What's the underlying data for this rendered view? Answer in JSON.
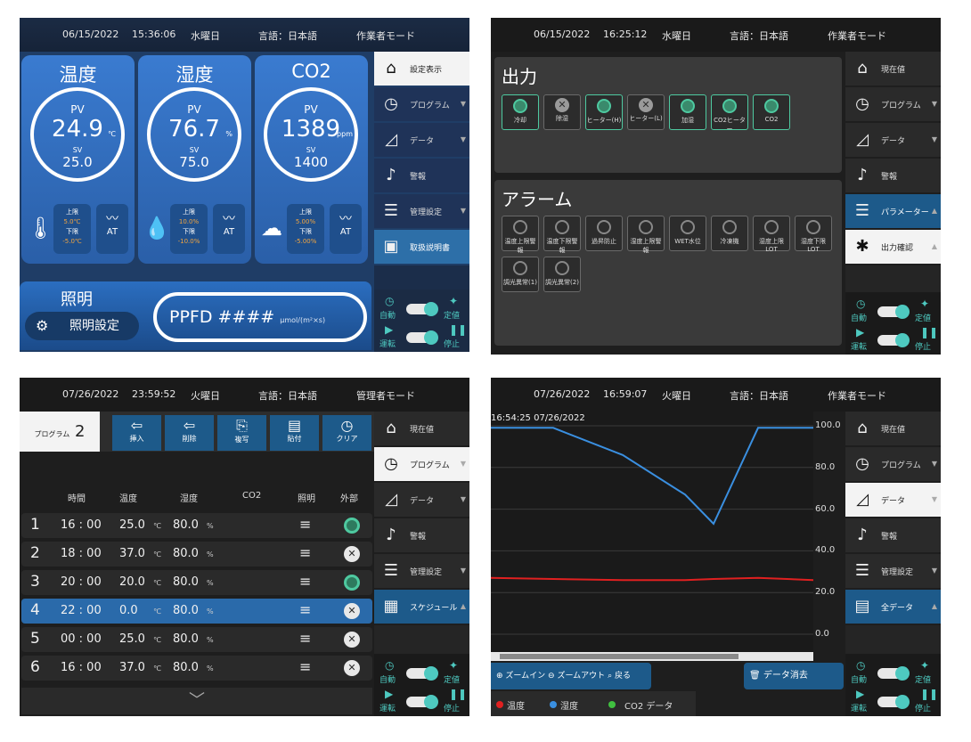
{
  "colors": {
    "accent": "#4ec9c0",
    "on_green": "#4ec9a0",
    "blue": "#1d5a8a",
    "temp_line": "#e02020",
    "humid_line": "#3a8fe0",
    "co2_dot": "#40c040"
  },
  "screen1": {
    "top_date": "06/15/2022",
    "top_time": "15:36:06",
    "top_day": "水曜日",
    "top_lang": "言語：日本語",
    "top_mode": "作業者モード",
    "gauges": [
      {
        "title": "温度",
        "pv_label": "PV",
        "value": "24.9",
        "unit": "℃",
        "sv_label": "SV",
        "setpoint": "25.0",
        "upper_label": "上限",
        "upper": "5.0℃",
        "lower_label": "下限",
        "lower": "-5.0℃",
        "at": "AT",
        "icon": "thermometer-icon"
      },
      {
        "title": "湿度",
        "pv_label": "PV",
        "value": "76.7",
        "unit": "%",
        "sv_label": "SV",
        "setpoint": "75.0",
        "upper_label": "上限",
        "upper": "10.0%",
        "lower_label": "下限",
        "lower": "-10.0%",
        "at": "AT",
        "icon": "droplet-icon"
      },
      {
        "title": "CO2",
        "pv_label": "PV",
        "value": "1389",
        "unit": "ppm",
        "sv_label": "SV",
        "setpoint": "1400",
        "upper_label": "上限",
        "upper": "5.00%",
        "lower_label": "下限",
        "lower": "-5.00%",
        "at": "AT",
        "icon": "co2-cloud-icon"
      }
    ],
    "lighting_title": "照明",
    "lighting_button": "照明設定",
    "ppfd_label": "PPFD ####",
    "ppfd_unit": "μmol/(m²×s)",
    "menu": [
      "設定表示",
      "プログラム",
      "データ",
      "警報",
      "管理設定",
      "取扱説明書"
    ],
    "ctrl_auto": "自動",
    "ctrl_fixed": "定値",
    "ctrl_run": "運転",
    "ctrl_stop": "停止"
  },
  "screen2": {
    "top_date": "06/15/2022",
    "top_time": "16:25:12",
    "top_day": "水曜日",
    "top_lang": "言語：日本語",
    "top_mode": "作業者モード",
    "output_title": "出力",
    "outputs": [
      {
        "label": "冷却",
        "on": true
      },
      {
        "label": "除湿",
        "on": false
      },
      {
        "label": "ヒーター(H)",
        "on": true
      },
      {
        "label": "ヒーター(L)",
        "on": false
      },
      {
        "label": "加湿",
        "on": true
      },
      {
        "label": "CO2ヒーター",
        "on": true
      },
      {
        "label": "CO2",
        "on": true
      }
    ],
    "alarm_title": "アラーム",
    "alarms": [
      "温度上限警報",
      "温度下限警報",
      "過昇防止",
      "湿度上限警報",
      "WET水位",
      "冷凍機",
      "湿度上限LOT",
      "湿度下限LOT",
      "調光異常(1)",
      "調光異常(2)"
    ],
    "menu": [
      "現在値",
      "プログラム",
      "データ",
      "警報",
      "パラメーター",
      "出力確認"
    ],
    "ctrl_auto": "自動",
    "ctrl_fixed": "定値",
    "ctrl_run": "運転",
    "ctrl_stop": "停止"
  },
  "screen3": {
    "top_date": "07/26/2022",
    "top_time": "23:59:52",
    "top_day": "火曜日",
    "top_lang": "言語：日本語",
    "top_mode": "管理者モード",
    "program_label": "プログラム",
    "program_no": "2",
    "tabs": [
      "挿入",
      "削除",
      "複写",
      "貼付",
      "クリア"
    ],
    "headers": {
      "time": "時間",
      "temp": "温度",
      "humid": "湿度",
      "co2": "CO2",
      "light": "照明",
      "signal": "外部"
    },
    "rows": [
      {
        "no": "1",
        "time": "16 : 00",
        "temp": "25.0",
        "humid": "80.0",
        "signal_on": true
      },
      {
        "no": "2",
        "time": "18 : 00",
        "temp": "37.0",
        "humid": "80.0",
        "signal_on": false
      },
      {
        "no": "3",
        "time": "20 : 00",
        "temp": "20.0",
        "humid": "80.0",
        "signal_on": true
      },
      {
        "no": "4",
        "time": "22 : 00",
        "temp": "0.0",
        "humid": "80.0",
        "signal_on": false
      },
      {
        "no": "5",
        "time": "00 : 00",
        "temp": "25.0",
        "humid": "80.0",
        "signal_on": false
      },
      {
        "no": "6",
        "time": "16 : 00",
        "temp": "37.0",
        "humid": "80.0",
        "signal_on": false
      }
    ],
    "unit_c": "℃",
    "unit_pct": "%",
    "menu": [
      "現在値",
      "プログラム",
      "データ",
      "警報",
      "管理設定",
      "スケジュール"
    ],
    "ctrl_auto": "自動",
    "ctrl_fixed": "定値",
    "ctrl_run": "運転",
    "ctrl_stop": "停止"
  },
  "screen4": {
    "top_date": "07/26/2022",
    "top_time": "16:59:07",
    "top_day": "火曜日",
    "top_lang": "言語：日本語",
    "top_mode": "作業者モード",
    "chart_stamp": "16:54:25 07/26/2022",
    "chart_data": {
      "type": "line",
      "ylim": [
        0,
        100
      ],
      "yticks": [
        "100.0",
        "80.0",
        "60.0",
        "40.0",
        "20.0",
        "0.0"
      ],
      "series": [
        {
          "name": "湿度",
          "color": "#3a8fe0",
          "values": [
            99,
            99,
            86,
            67,
            53,
            99,
            99
          ]
        },
        {
          "name": "温度",
          "color": "#e02020",
          "values": [
            27,
            26.5,
            26,
            26,
            26.5,
            27,
            26
          ]
        }
      ]
    },
    "btn_zoom_in": "ズームイン",
    "btn_zoom_out": "ズームアウト",
    "btn_restore": "戻る",
    "btn_clear": "データ消去",
    "legend": [
      "温度",
      "湿度",
      "CO2 データ"
    ],
    "menu": [
      "現在値",
      "プログラム",
      "データ",
      "警報",
      "管理設定",
      "全データ"
    ],
    "ctrl_auto": "自動",
    "ctrl_fixed": "定値",
    "ctrl_run": "運転",
    "ctrl_stop": "停止"
  }
}
